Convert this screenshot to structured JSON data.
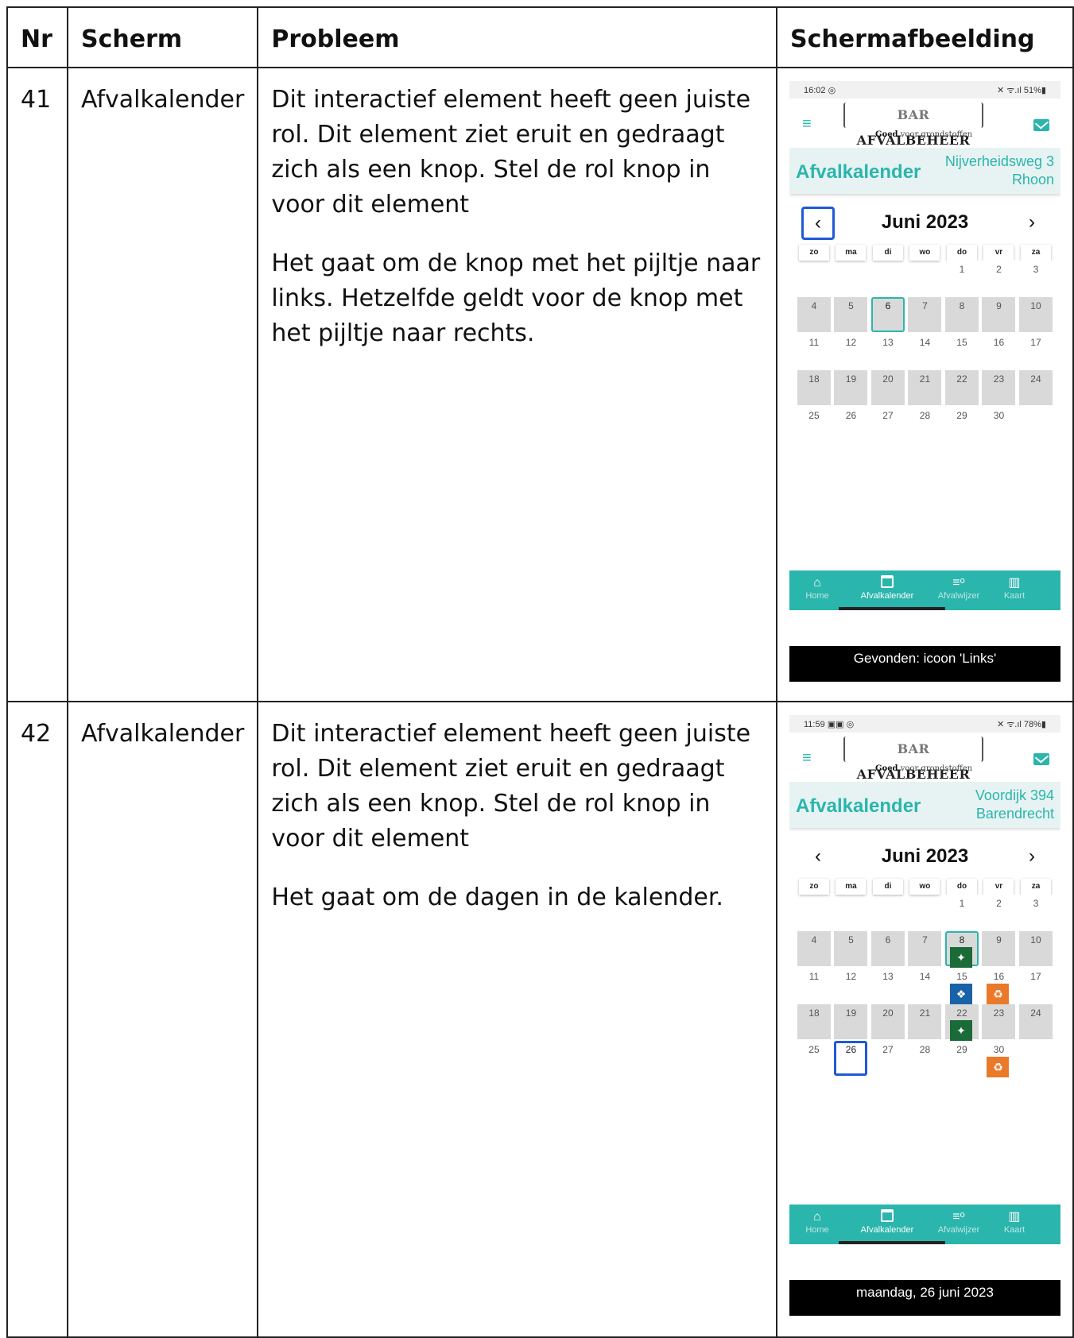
{
  "headers": {
    "nr": "Nr",
    "scherm": "Scherm",
    "probleem": "Probleem",
    "screenshot": "Schermafbeelding"
  },
  "rows": [
    {
      "nr": "41",
      "scherm": "Afvalkalender",
      "p1": "Dit interactief element heeft geen juiste rol. Dit element ziet eruit en gedraagt zich als een knop. Stel de rol knop in voor dit element",
      "p2": "Het gaat om de knop met het pijltje naar links. Hetzelfde geldt voor de knop met het pijltje naar rechts.",
      "phone": {
        "status_time": "16:02 ◎",
        "status_right": "✕ ᯤ.ıl 51%▮",
        "title": "Afvalkalender",
        "addr1": "Nijverheidsweg 3",
        "addr2": "Rhoon",
        "month": "Juni 2023",
        "prev": "‹",
        "next": "›",
        "announce": "Gevonden: icoon 'Links'"
      }
    },
    {
      "nr": "42",
      "scherm": "Afvalkalender",
      "p1": "Dit interactief element heeft geen juiste rol. Dit element ziet eruit en gedraagt zich als een knop. Stel de rol knop in voor dit element",
      "p2": "Het gaat om de dagen in de kalender.",
      "phone": {
        "status_time": "11:59 ▣▣ ◎",
        "status_right": "✕ ᯤ.ıl 78%▮",
        "title": "Afvalkalender",
        "addr1": "Voordijk 394",
        "addr2": "Barendrecht",
        "month": "Juni 2023",
        "prev": "‹",
        "next": "›",
        "announce": "maandag, 26 juni 2023"
      }
    }
  ],
  "app": {
    "logo_bar": "BAR",
    "logo_name": "AFVALBEHEER",
    "tagline_bold": "Goed",
    "tagline_rest": "voor grondstoffen",
    "weekdays": [
      "zo",
      "ma",
      "di",
      "wo",
      "do",
      "vr",
      "za"
    ],
    "nav": [
      "Home",
      "Afvalkalender",
      "Afvalwijzer",
      "Kaart"
    ],
    "menu_icon": "≡",
    "accent": "#2ab5ad",
    "focus": "#1e5ad8"
  }
}
